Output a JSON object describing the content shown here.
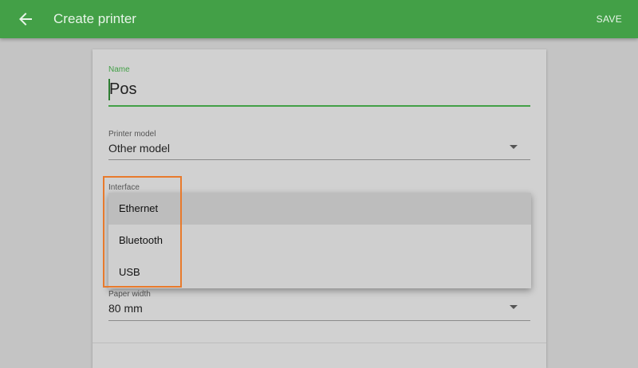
{
  "appbar": {
    "title": "Create printer",
    "save_label": "SAVE",
    "back_icon": "arrow-back-icon",
    "color": "#43a047"
  },
  "form": {
    "name": {
      "label": "Name",
      "value": "Pos"
    },
    "printer_model": {
      "label": "Printer model",
      "value": "Other model"
    },
    "interface": {
      "label": "Interface",
      "options": [
        "Ethernet",
        "Bluetooth",
        "USB"
      ],
      "highlighted": "Ethernet"
    },
    "paper_width": {
      "label": "Paper width",
      "value": "80 mm"
    }
  },
  "highlight_color": "#e87a2c"
}
